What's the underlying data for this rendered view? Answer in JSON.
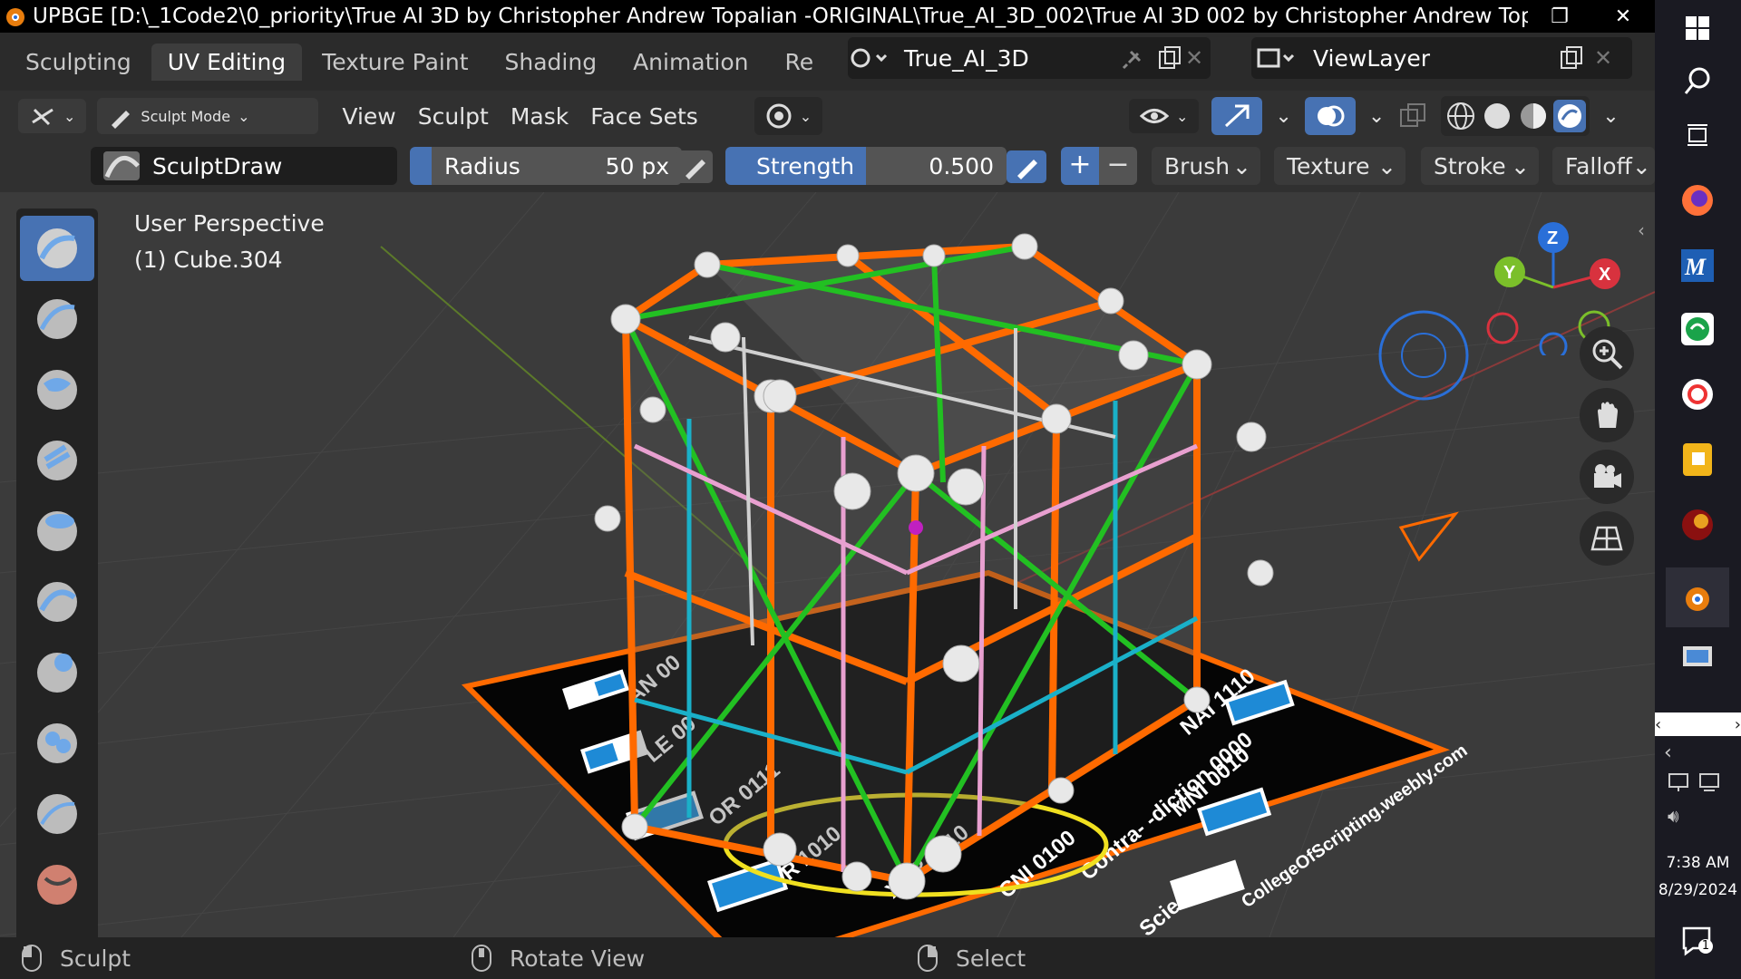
{
  "window": {
    "title": "UPBGE [D:\\_1Code2\\0_priority\\True AI 3D by Christopher Andrew Topalian -ORIGINAL\\True_AI_3D_002\\True AI 3D 002 by Christopher Andrew Topal..."
  },
  "workspace_tabs": [
    "Sculpting",
    "UV Editing",
    "Texture Paint",
    "Shading",
    "Animation",
    "Re"
  ],
  "scene": {
    "name": "True_AI_3D"
  },
  "view_layer": {
    "name": "ViewLayer"
  },
  "header": {
    "mode_label": "Sculpt Mode",
    "menus": [
      "View",
      "Sculpt",
      "Mask",
      "Face Sets"
    ]
  },
  "tool_settings": {
    "brush_name": "SculptDraw",
    "radius_label": "Radius",
    "radius_value": "50 px",
    "strength_label": "Strength",
    "strength_value": "0.500",
    "plus": "+",
    "minus": "−",
    "dropdowns": [
      "Brush",
      "Texture",
      "Stroke",
      "Falloff"
    ]
  },
  "viewport": {
    "perspective_label": "User Perspective",
    "object_label": "(1) Cube.304",
    "gizmo": {
      "z": "Z",
      "y": "Y",
      "x": "X"
    },
    "board_labels": [
      {
        "text": "AN 00"
      },
      {
        "text": "LE 00"
      },
      {
        "text": "OR 0111"
      },
      {
        "text": "R 1010"
      },
      {
        "text": "XOR 0110"
      },
      {
        "text": "CNI 0100"
      },
      {
        "text": "Contra- -diction 0000"
      },
      {
        "text": "MNI 0010"
      },
      {
        "text": "NAI 1110"
      },
      {
        "text": "CollegeOfScripting.weebly.com"
      },
      {
        "text": "Scie"
      }
    ]
  },
  "status_bar": {
    "items": [
      "Sculpt",
      "Rotate View",
      "Select"
    ]
  },
  "taskbar": {
    "time": "7:38 AM",
    "date": "8/29/2024",
    "notification_count": "1"
  },
  "colors": {
    "accent_blue": "#4772b3",
    "orange": "#ff6a00",
    "green": "#22c022",
    "gizmo_x": "#d8323e",
    "gizmo_y": "#7bbf2a",
    "gizmo_z": "#2a6fd8"
  }
}
